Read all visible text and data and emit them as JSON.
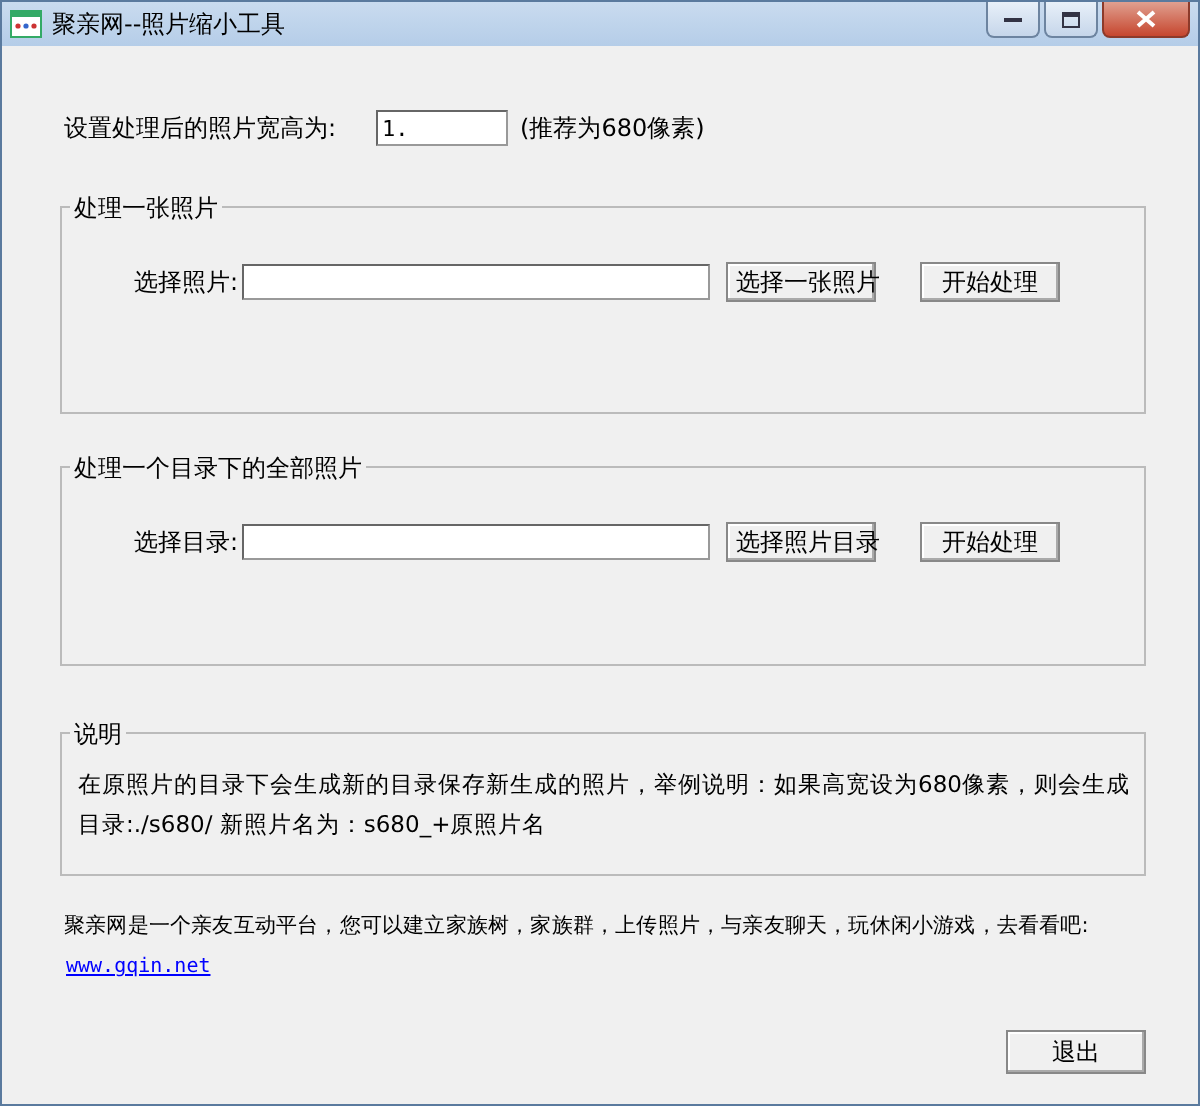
{
  "window": {
    "title": "聚亲网--照片缩小工具"
  },
  "size_setting": {
    "label": "设置处理后的照片宽高为:",
    "value": "1.",
    "hint": "(推荐为680像素)"
  },
  "groups": [
    {
      "title": "处理一张照片",
      "label": "选择照片:",
      "buttons": [
        "选择一张照片",
        "开始处理"
      ]
    },
    {
      "title": "处理一个目录下的全部照片",
      "label": "选择目录:",
      "buttons": [
        "选择照片目录",
        "开始处理"
      ]
    }
  ],
  "note": {
    "title": "说明",
    "text": "在原照片的目录下会生成新的目录保存新生成的照片，举例说明：如果高宽设为680像素，则会生成目录:./s680/ 新照片名为：s680_+原照片名"
  },
  "footer": {
    "text": "聚亲网是一个亲友互动平台，您可以建立家族树，家族群，上传照片，与亲友聊天，玩休闲小游戏，去看看吧:",
    "link": "www.gqin.net"
  },
  "exit_button": "退出"
}
